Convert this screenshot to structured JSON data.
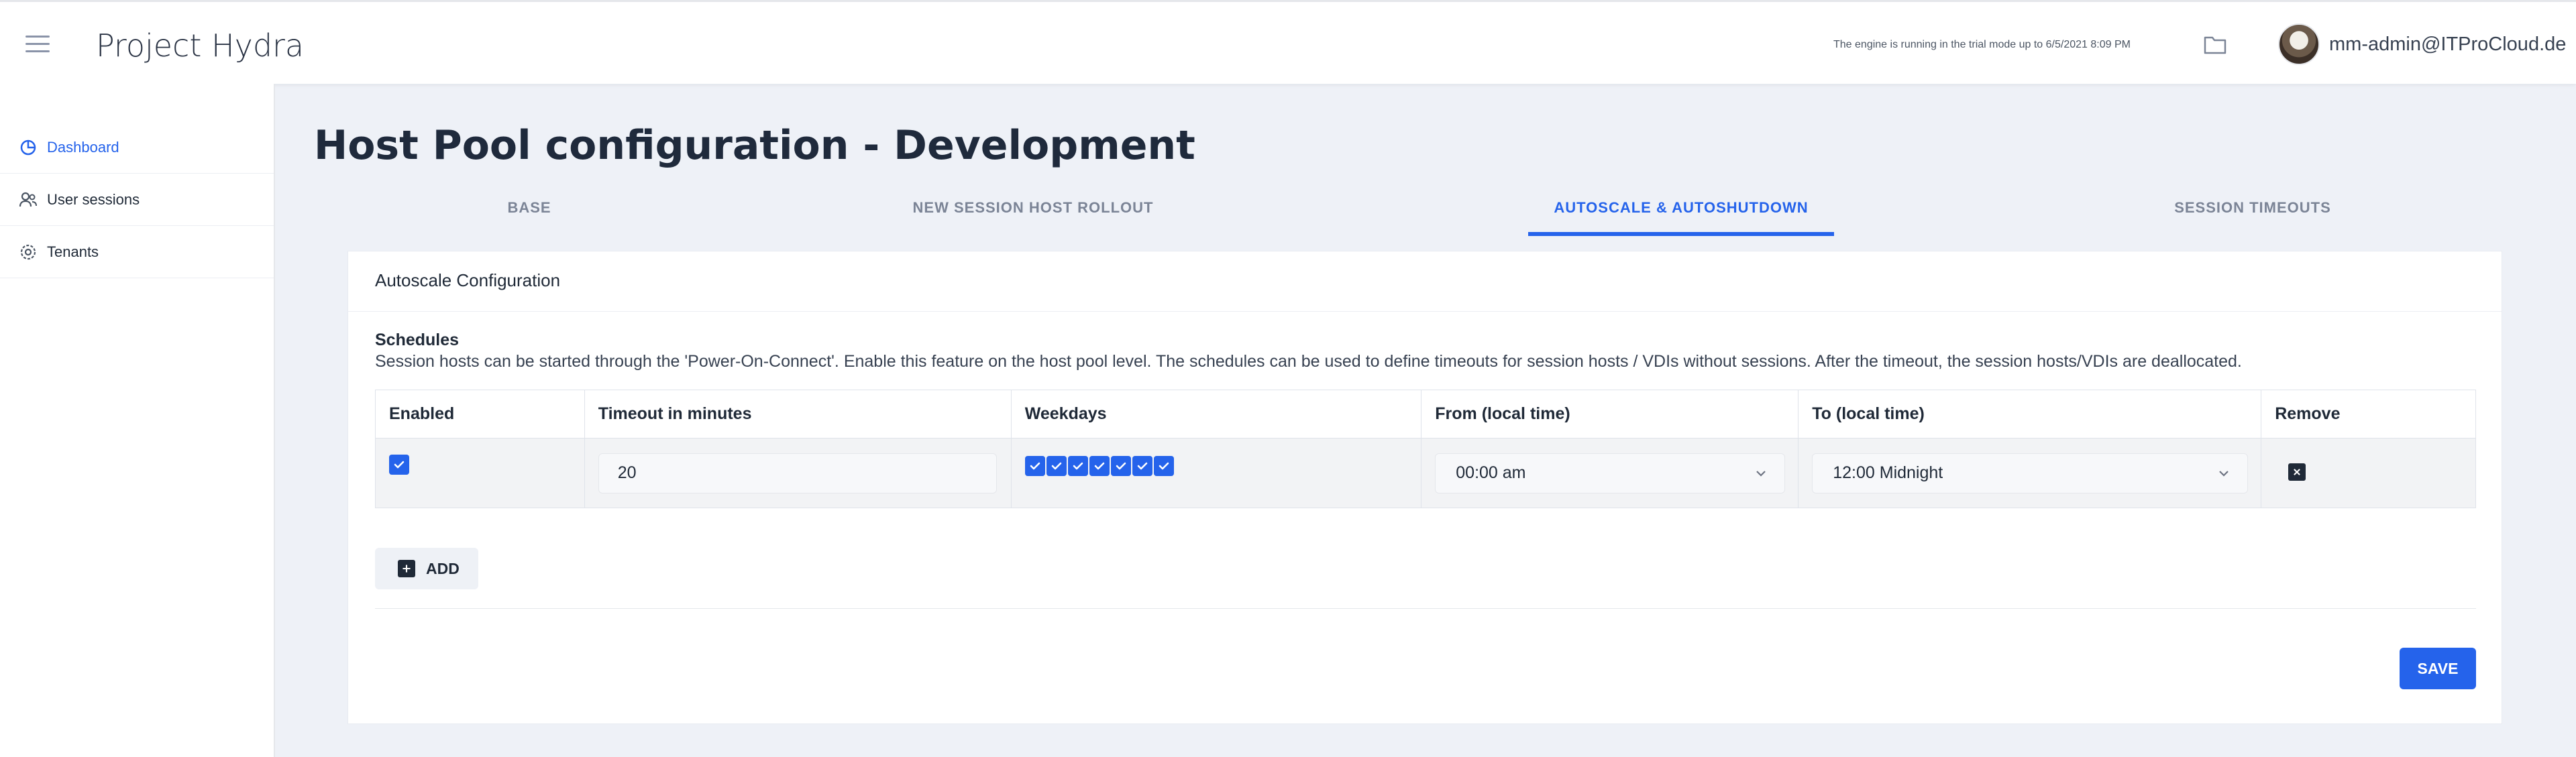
{
  "app": {
    "title": "Project Hydra"
  },
  "header": {
    "trial_notice": "The engine is running in the trial mode up to 6/5/2021 8:09 PM",
    "user_email": "mm-admin@ITProCloud.de"
  },
  "sidebar": {
    "items": [
      {
        "label": "Dashboard",
        "icon": "pie-chart-icon",
        "active": true
      },
      {
        "label": "User sessions",
        "icon": "users-icon",
        "active": false
      },
      {
        "label": "Tenants",
        "icon": "gear-icon",
        "active": false
      }
    ]
  },
  "main": {
    "page_title": "Host Pool configuration - Development",
    "tabs": [
      {
        "label": "BASE",
        "active": false
      },
      {
        "label": "NEW SESSION HOST ROLLOUT",
        "active": false
      },
      {
        "label": "AUTOSCALE & AUTOSHUTDOWN",
        "active": true
      },
      {
        "label": "SESSION TIMEOUTS",
        "active": false
      }
    ],
    "card": {
      "title": "Autoscale Configuration",
      "section_title": "Schedules",
      "section_description": "Session hosts can be started through the 'Power-On-Connect'. Enable this feature on the host pool level. The schedules can be used to define timeouts for session hosts / VDIs without sessions. After the timeout, the session hosts/VDIs are deallocated.",
      "table": {
        "columns": [
          "Enabled",
          "Timeout in minutes",
          "Weekdays",
          "From (local time)",
          "To (local time)",
          "Remove"
        ],
        "rows": [
          {
            "enabled": true,
            "timeout": "20",
            "weekdays_checked": [
              true,
              true,
              true,
              true,
              true,
              true,
              true
            ],
            "from": "00:00 am",
            "to": "12:00 Midnight"
          }
        ]
      },
      "add_label": "ADD",
      "save_label": "SAVE"
    }
  },
  "colors": {
    "accent": "#2563eb",
    "background": "#eef1f7",
    "text_dark": "#1f2937"
  }
}
